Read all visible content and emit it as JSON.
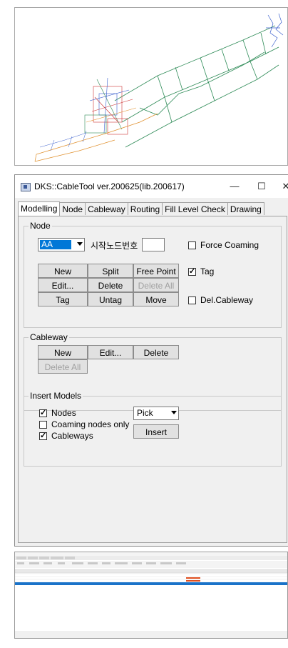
{
  "colors": {
    "accent": "#0078d7",
    "model_green": "#2e8b57",
    "model_blue": "#3a5fcd",
    "model_red": "#cc3333",
    "model_orange": "#e0912f",
    "selected_row": "#1a73c9"
  },
  "viewport": {
    "description_icon": "3d-ship-model-icon"
  },
  "window": {
    "title": "DKS::CableTool ver.200625(lib.200617)",
    "minimize": "—",
    "maximize": "☐",
    "close": "✕"
  },
  "tabs": [
    {
      "label": "Modelling",
      "active": true
    },
    {
      "label": "Node",
      "active": false
    },
    {
      "label": "Cableway",
      "active": false
    },
    {
      "label": "Routing",
      "active": false
    },
    {
      "label": "Fill Level Check",
      "active": false
    },
    {
      "label": "Drawing",
      "active": false
    }
  ],
  "node_group": {
    "legend": "Node",
    "combo_value": "AA",
    "start_node_label": "시작노드번호",
    "start_node_value": "",
    "force_coaming": {
      "label": "Force Coaming",
      "checked": false
    },
    "tag": {
      "label": "Tag",
      "checked": true
    },
    "del_cableway": {
      "label": "Del.Cableway",
      "checked": false
    },
    "buttons": {
      "new": "New",
      "split": "Split",
      "free_point": "Free Point",
      "edit": "Edit...",
      "delete": "Delete",
      "delete_all": "Delete All",
      "tag": "Tag",
      "untag": "Untag",
      "move": "Move"
    }
  },
  "cableway_group": {
    "legend": "Cableway",
    "buttons": {
      "new": "New",
      "edit": "Edit...",
      "delete": "Delete",
      "delete_all": "Delete All"
    }
  },
  "insert_group": {
    "legend": "Insert Models",
    "nodes": {
      "label": "Nodes",
      "checked": true
    },
    "coaming_only": {
      "label": "Coaming nodes only",
      "checked": false
    },
    "cableways": {
      "label": "Cableways",
      "checked": true
    },
    "mode_value": "Pick",
    "insert_button": "Insert"
  }
}
